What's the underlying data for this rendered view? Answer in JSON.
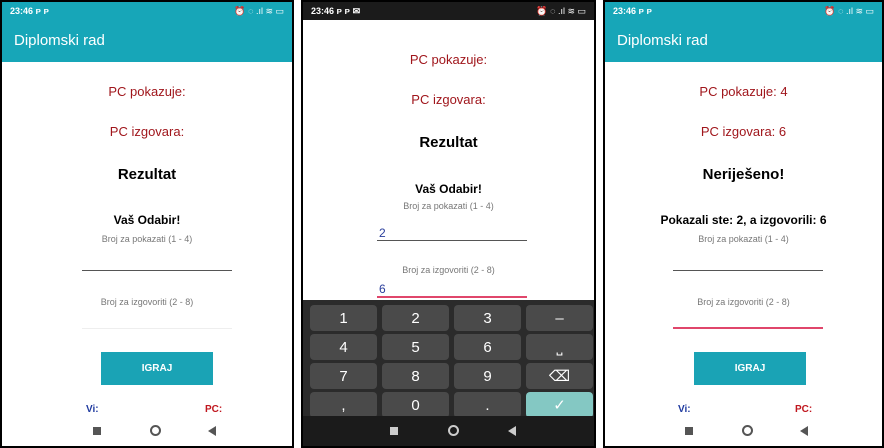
{
  "phone1": {
    "time": "23:46 ᴘ ᴘ",
    "status_icons": "⏰ ◌ .ıl ≋ ▭",
    "app_title": "Diplomski rad",
    "pc_pokazuje": "PC pokazuje:",
    "pc_izgovara": "PC izgovara:",
    "result": "Rezultat",
    "your_choice": "Vaš Odabir!",
    "hint_show": "Broj za pokazati (1 - 4)",
    "hint_say": "Broj za izgovoriti (2 - 8)",
    "play_button": "IGRAJ",
    "vi_label": "Vi:",
    "pc_label": "PC:"
  },
  "phone2": {
    "time": "23:46 ᴘ ᴘ ✉",
    "status_icons": "⏰ ◌ .ıl ≋ ▭",
    "pc_pokazuje": "PC pokazuje:",
    "pc_izgovara": "PC izgovara:",
    "result": "Rezultat",
    "your_choice": "Vaš Odabir!",
    "hint_show": "Broj za pokazati (1 - 4)",
    "value_show": "2",
    "hint_say": "Broj za izgovoriti (2 - 8)",
    "value_say": "6",
    "keys": [
      "1",
      "2",
      "3",
      "–",
      "4",
      "5",
      "6",
      "⎵",
      "7",
      "8",
      "9",
      "⌫",
      ",",
      "0",
      ".",
      "✓"
    ]
  },
  "phone3": {
    "time": "23:46 ᴘ ᴘ",
    "status_icons": "⏰ ◌ .ıl ≋ ▭",
    "app_title": "Diplomski rad",
    "pc_pokazuje": "PC pokazuje: 4",
    "pc_izgovara": "PC izgovara: 6",
    "result": "Neriješeno!",
    "your_choice": "Pokazali ste: 2, a izgovorili: 6",
    "hint_show": "Broj za pokazati (1 - 4)",
    "hint_say": "Broj za izgovoriti (2 - 8)",
    "play_button": "IGRAJ",
    "vi_label": "Vi:",
    "pc_label": "PC:"
  },
  "colors": {
    "accent": "#17a6b8",
    "red_text": "#a0161c",
    "blue_text": "#1f3a9f",
    "pink_line": "#e0466b"
  },
  "icons": [
    "nav-recents-icon",
    "nav-home-icon",
    "nav-back-icon",
    "backspace-icon",
    "check-icon"
  ]
}
